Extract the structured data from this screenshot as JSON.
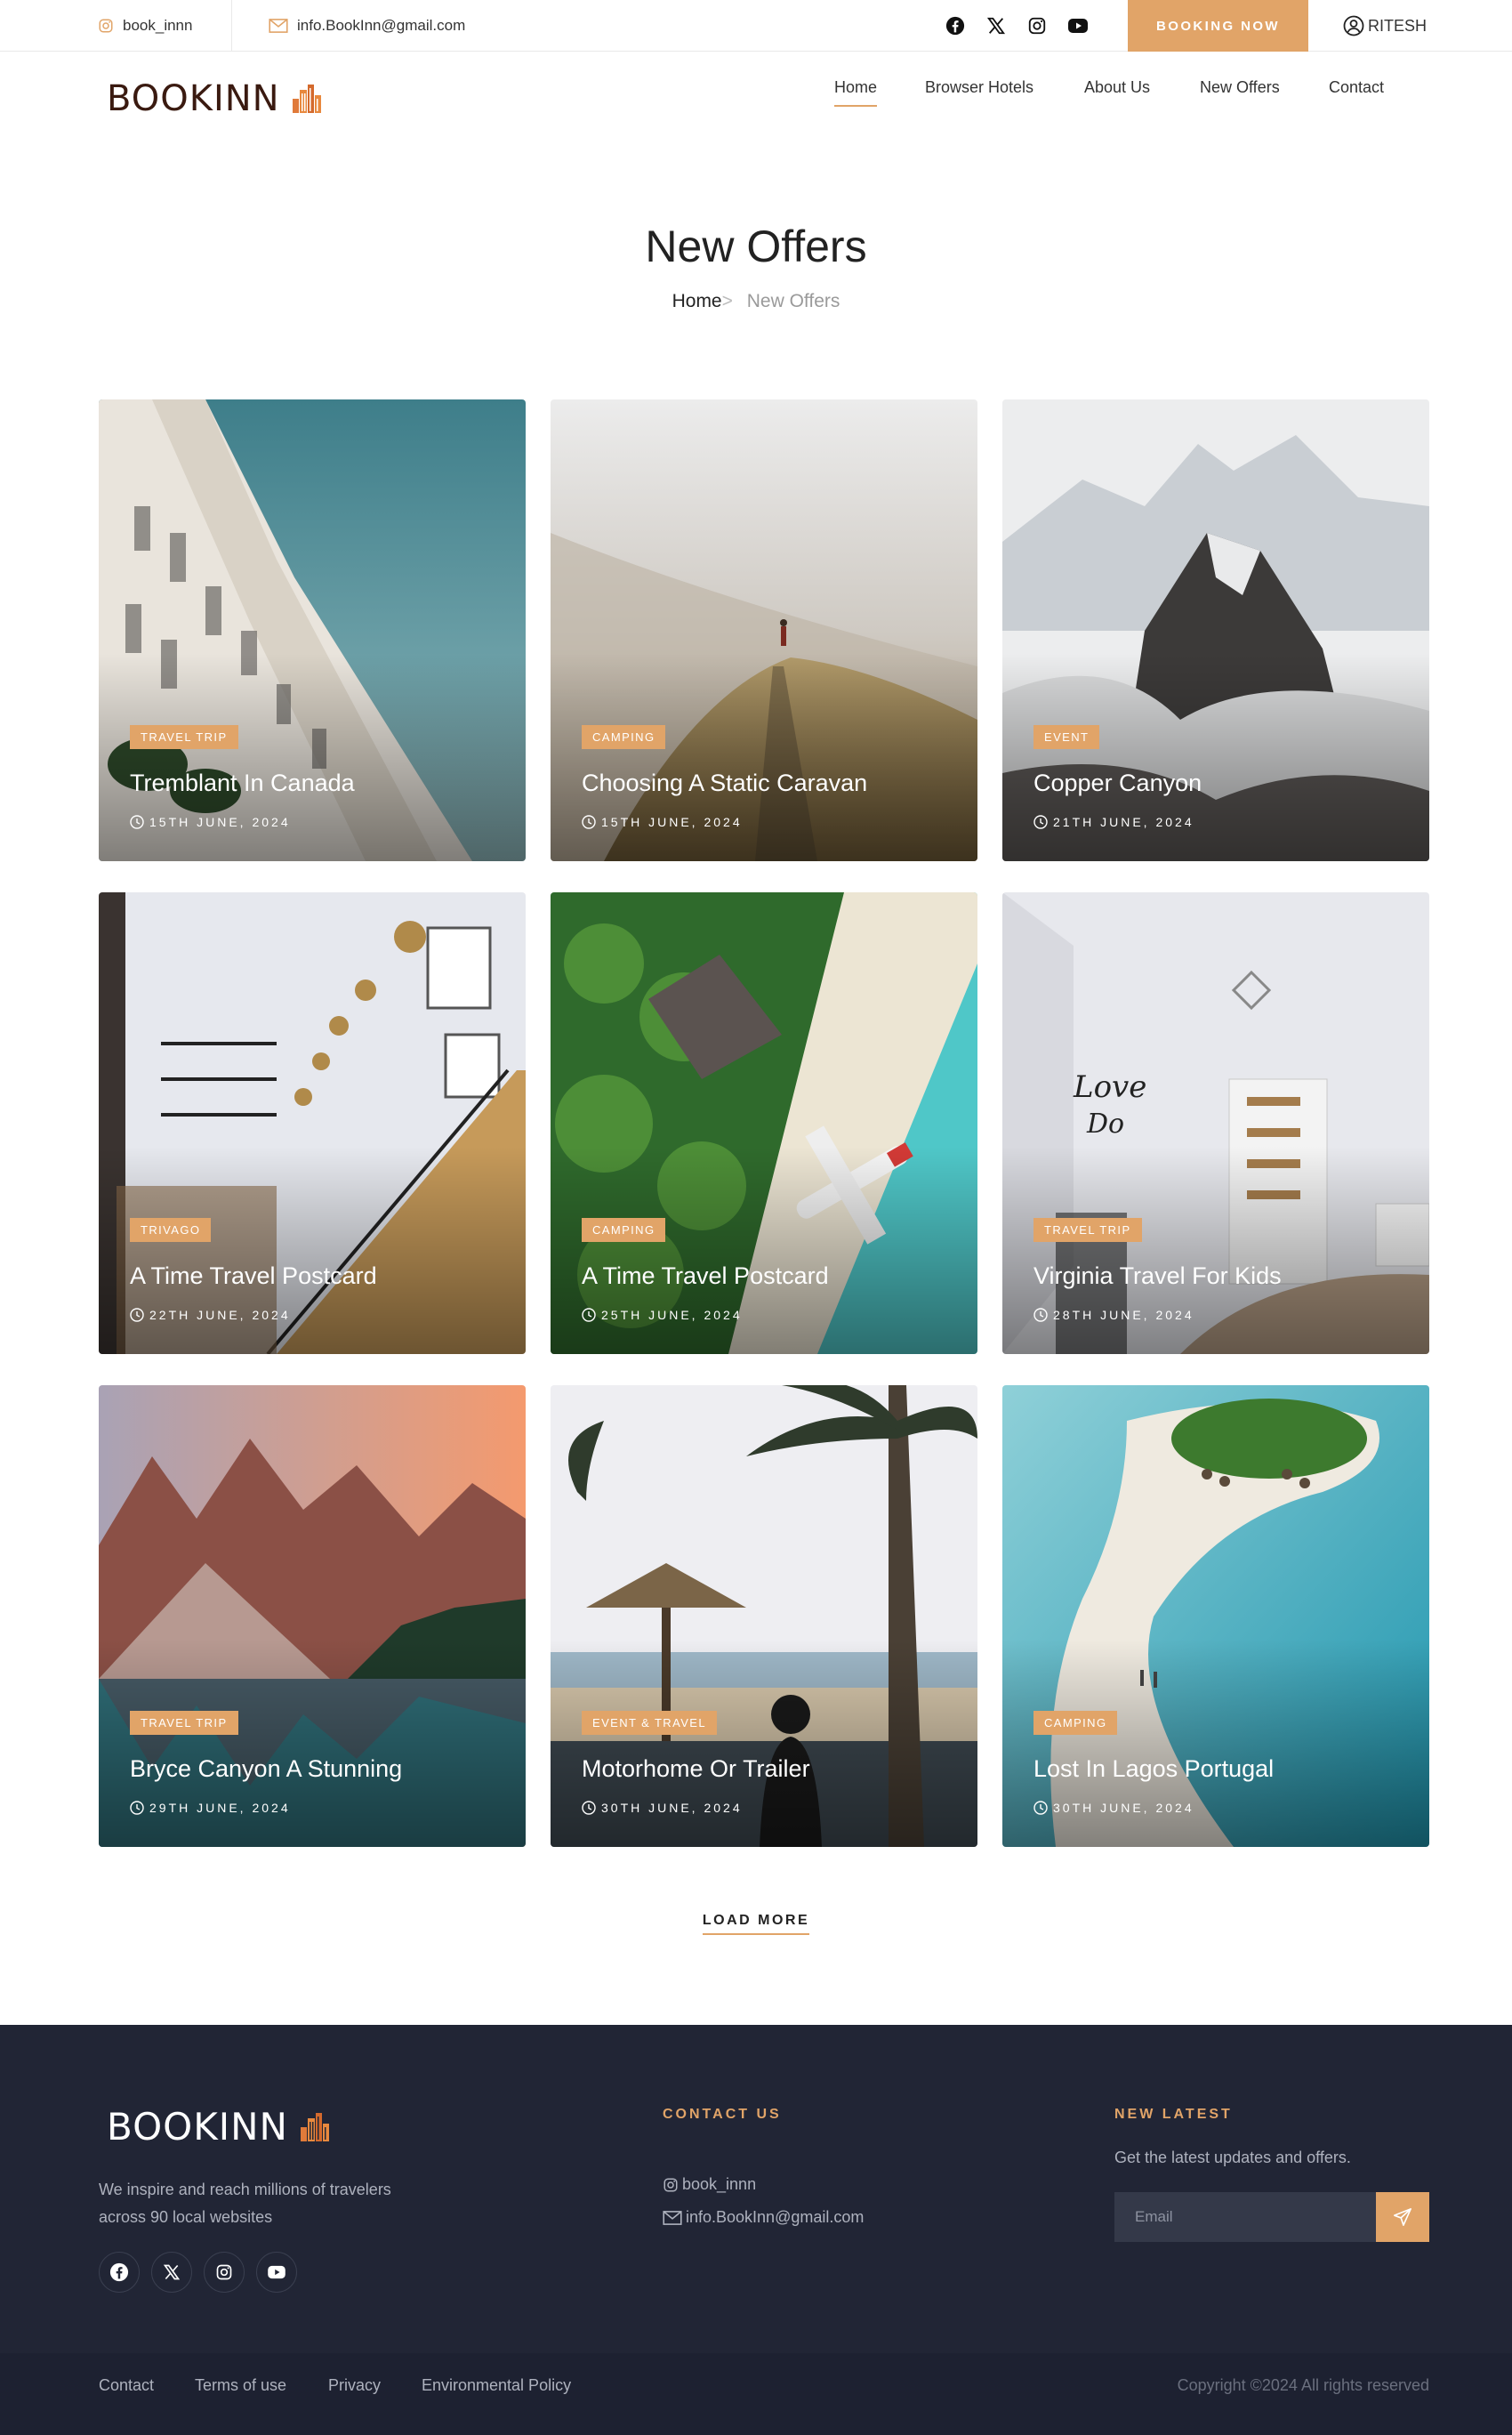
{
  "topbar": {
    "instagram_handle": "book_innn",
    "email": "info.BookInn@gmail.com",
    "social_icons": [
      "facebook-icon",
      "x-icon",
      "instagram-icon",
      "youtube-icon"
    ],
    "booking_label": "BOOKING NOW",
    "user_name": "RITESH"
  },
  "brand": {
    "logo_text": "BOOKINN",
    "accent_color": "#e1a468",
    "logo_color": "#3a1a10",
    "footer_bg": "#212535"
  },
  "nav": {
    "items": [
      {
        "label": "Home",
        "active": true
      },
      {
        "label": "Browser Hotels"
      },
      {
        "label": "About Us"
      },
      {
        "label": "New Offers"
      },
      {
        "label": "Contact"
      }
    ]
  },
  "hero": {
    "title": "New Offers",
    "breadcrumb_home": "Home",
    "breadcrumb_sep": ">",
    "breadcrumb_current": "New Offers"
  },
  "offers": [
    {
      "tag": "TRAVEL TRIP",
      "title": "Tremblant In Canada",
      "date": "15TH JUNE, 2024",
      "image": "hotel-building-sky"
    },
    {
      "tag": "CAMPING",
      "title": "Choosing A Static Caravan",
      "date": "15TH JUNE, 2024",
      "image": "hill-hiker-fog"
    },
    {
      "tag": "EVENT",
      "title": "Copper Canyon",
      "date": "21TH JUNE, 2024",
      "image": "snowy-mountain-peak"
    },
    {
      "tag": "TRIVAGO",
      "title": "A Time Travel Postcard",
      "date": "22TH JUNE, 2024",
      "image": "staircase-interior"
    },
    {
      "tag": "CAMPING",
      "title": "A Time Travel Postcard",
      "date": "25TH JUNE, 2024",
      "image": "tropical-beach-seaplane"
    },
    {
      "tag": "TRAVEL TRIP",
      "title": "Virginia Travel For Kids",
      "date": "28TH JUNE, 2024",
      "image": "white-bedroom"
    },
    {
      "tag": "TRAVEL TRIP",
      "title": "Bryce Canyon A Stunning",
      "date": "29TH JUNE, 2024",
      "image": "mountain-lake-sunset"
    },
    {
      "tag": "EVENT & TRAVEL",
      "title": "Motorhome Or Trailer",
      "date": "30TH JUNE, 2024",
      "image": "palm-beach-pool"
    },
    {
      "tag": "CAMPING",
      "title": "Lost In Lagos Portugal",
      "date": "30TH JUNE, 2024",
      "image": "sandbar-island"
    }
  ],
  "load_more": "LOAD MORE",
  "footer": {
    "logo_text": "BOOKINN",
    "description": "We inspire and reach millions of travelers across 90 local websites",
    "social_icons": [
      "facebook-icon",
      "x-icon",
      "instagram-icon",
      "youtube-icon"
    ],
    "contact_heading": "CONTACT US",
    "contact_instagram": "book_innn",
    "contact_email": "info.BookInn@gmail.com",
    "news_heading": "NEW LATEST",
    "news_text": "Get the latest updates and offers.",
    "email_placeholder": "Email",
    "links": [
      "Contact",
      "Terms of use",
      "Privacy",
      "Environmental Policy"
    ],
    "copyright": "Copyright ©2024 All rights reserved"
  }
}
